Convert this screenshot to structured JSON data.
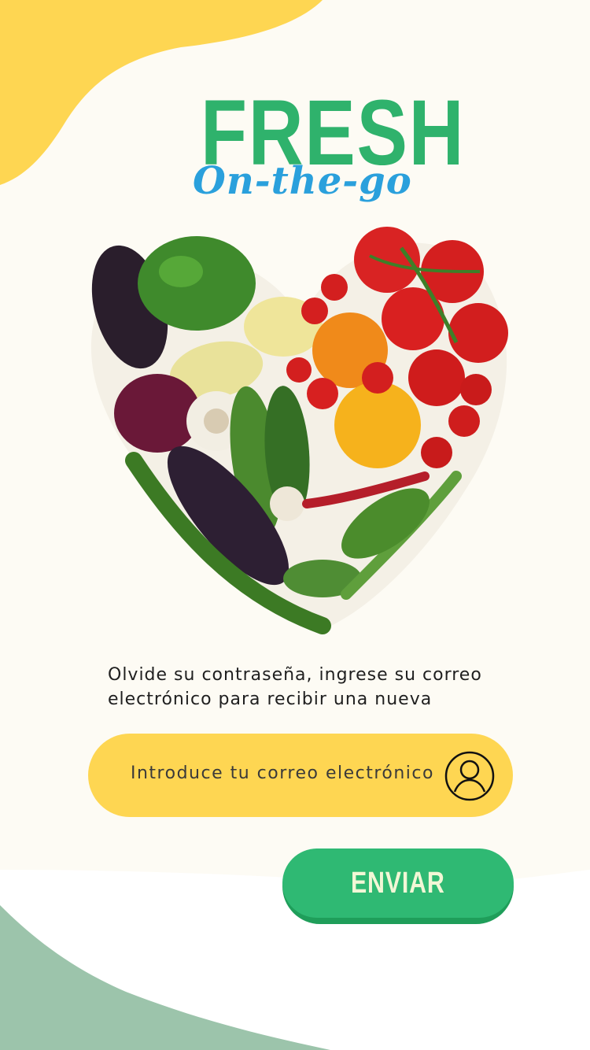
{
  "logo": {
    "line1": "FRESH",
    "line2": "On-the-go"
  },
  "colors": {
    "yellow": "#fed652",
    "green": "#2fb973",
    "blue": "#2aa0dc",
    "sage": "#9cc4ab"
  },
  "message": {
    "line1": "Olvide su contraseña, ingrese su correo",
    "line2": "electrónico para recibir una nueva"
  },
  "email": {
    "placeholder": "Introduce tu correo electrónico",
    "icon": "user-icon"
  },
  "send_button": {
    "label": "ENVIAR"
  },
  "hero": {
    "icon": "vegetable-heart-image"
  }
}
